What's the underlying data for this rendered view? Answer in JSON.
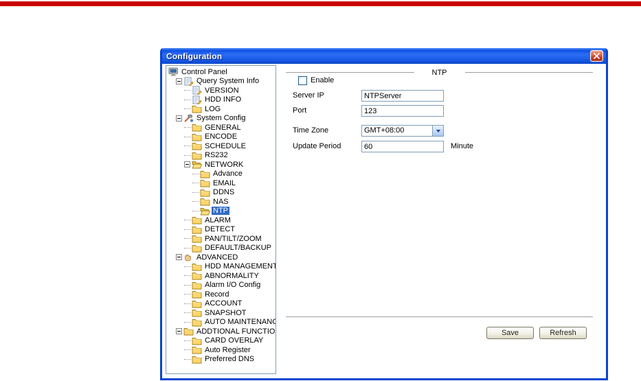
{
  "page": {
    "top_bar_color": "#c90003",
    "selection_color": "#316ac5",
    "titlebar_gradient_base": "#2061ee"
  },
  "window": {
    "title": "Configuration",
    "close_icon": "close-icon"
  },
  "tree": {
    "items": [
      {
        "label": "Control Panel",
        "level": 0,
        "icon": "computer"
      },
      {
        "label": "Query System Info",
        "level": 1,
        "icon": "notes",
        "expander": "minus"
      },
      {
        "label": "VERSION",
        "level": 2,
        "icon": "notes"
      },
      {
        "label": "HDD INFO",
        "level": 2,
        "icon": "notes"
      },
      {
        "label": "LOG",
        "level": 2,
        "icon": "folder"
      },
      {
        "label": "System Config",
        "level": 1,
        "icon": "tools",
        "expander": "minus"
      },
      {
        "label": "GENERAL",
        "level": 2,
        "icon": "folder"
      },
      {
        "label": "ENCODE",
        "level": 2,
        "icon": "folder"
      },
      {
        "label": "SCHEDULE",
        "level": 2,
        "icon": "folder"
      },
      {
        "label": "RS232",
        "level": 2,
        "icon": "folder"
      },
      {
        "label": "NETWORK",
        "level": 2,
        "icon": "folder-open",
        "expander": "minus"
      },
      {
        "label": "Advance",
        "level": 3,
        "icon": "folder"
      },
      {
        "label": "EMAIL",
        "level": 3,
        "icon": "folder"
      },
      {
        "label": "DDNS",
        "level": 3,
        "icon": "folder"
      },
      {
        "label": "NAS",
        "level": 3,
        "icon": "folder"
      },
      {
        "label": "NTP",
        "level": 3,
        "icon": "folder-open",
        "selected": true
      },
      {
        "label": "ALARM",
        "level": 2,
        "icon": "folder"
      },
      {
        "label": "DETECT",
        "level": 2,
        "icon": "folder"
      },
      {
        "label": "PAN/TILT/ZOOM",
        "level": 2,
        "icon": "folder"
      },
      {
        "label": "DEFAULT/BACKUP",
        "level": 2,
        "icon": "folder"
      },
      {
        "label": "ADVANCED",
        "level": 1,
        "icon": "hand",
        "expander": "minus"
      },
      {
        "label": "HDD MANAGEMENT",
        "level": 2,
        "icon": "folder"
      },
      {
        "label": "ABNORMALITY",
        "level": 2,
        "icon": "folder"
      },
      {
        "label": "Alarm I/O Config",
        "level": 2,
        "icon": "folder"
      },
      {
        "label": "Record",
        "level": 2,
        "icon": "folder"
      },
      {
        "label": "ACCOUNT",
        "level": 2,
        "icon": "folder"
      },
      {
        "label": "SNAPSHOT",
        "level": 2,
        "icon": "folder"
      },
      {
        "label": "AUTO MAINTENANCE",
        "level": 2,
        "icon": "folder"
      },
      {
        "label": "ADDTIONAL FUNCTION",
        "level": 1,
        "icon": "folder",
        "expander": "minus"
      },
      {
        "label": "CARD OVERLAY",
        "level": 2,
        "icon": "folder"
      },
      {
        "label": "Auto Register",
        "level": 2,
        "icon": "folder"
      },
      {
        "label": "Preferred DNS",
        "level": 2,
        "icon": "folder"
      }
    ]
  },
  "ntp": {
    "header": "NTP",
    "enable": {
      "label": "Enable",
      "checked": false
    },
    "server_ip": {
      "label": "Server IP",
      "value": "NTPServer"
    },
    "port": {
      "label": "Port",
      "value": "123"
    },
    "time_zone": {
      "label": "Time Zone",
      "value": "GMT+08:00"
    },
    "update_period": {
      "label": "Update Period",
      "value": "60",
      "unit": "Minute"
    },
    "buttons": {
      "save": "Save",
      "refresh": "Refresh"
    }
  }
}
